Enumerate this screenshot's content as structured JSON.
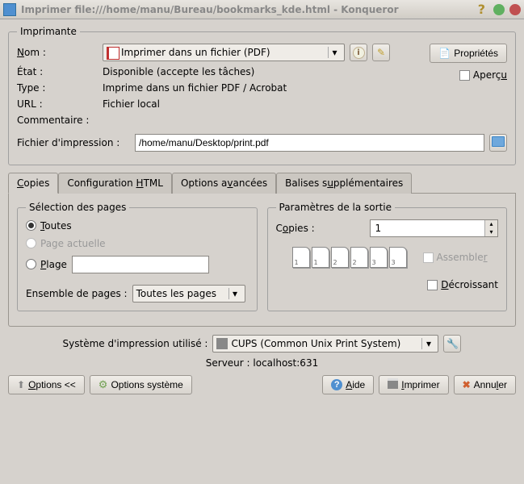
{
  "window": {
    "title": "Imprimer file:///home/manu/Bureau/bookmarks_kde.html - Konqueror"
  },
  "printer_group": {
    "legend": "Imprimante",
    "name_label": "Nom :",
    "name_value": "Imprimer dans un fichier (PDF)",
    "state_label": "État :",
    "state_value": "Disponible (accepte les tâches)",
    "type_label": "Type :",
    "type_value": "Imprime dans un fichier PDF / Acrobat",
    "url_label": "URL :",
    "url_value": "Fichier local",
    "comment_label": "Commentaire :",
    "comment_value": "",
    "output_label": "Fichier d'impression :",
    "output_value": "/home/manu/Desktop/print.pdf",
    "properties_btn": "Propriétés",
    "preview_label": "Aperçu"
  },
  "tabs": {
    "copies": "Copies",
    "html": "Configuration HTML",
    "advanced": "Options avancées",
    "extra": "Balises supplémentaires"
  },
  "copies_tab": {
    "page_sel_legend": "Sélection des pages",
    "radio_all": "Toutes",
    "radio_current": "Page actuelle",
    "radio_range": "Plage",
    "pageset_label": "Ensemble de pages :",
    "pageset_value": "Toutes les pages",
    "output_legend": "Paramètres de la sortie",
    "copies_label": "Copies :",
    "copies_value": "1",
    "collate_label": "Assembler",
    "reverse_label": "Décroissant"
  },
  "system": {
    "label": "Système d'impression utilisé :",
    "value": "CUPS (Common Unix Print System)",
    "server_label": "Serveur : localhost:631"
  },
  "buttons": {
    "options": "Options <<",
    "sys_options": "Options système",
    "help": "Aide",
    "print": "Imprimer",
    "cancel": "Annuler"
  }
}
